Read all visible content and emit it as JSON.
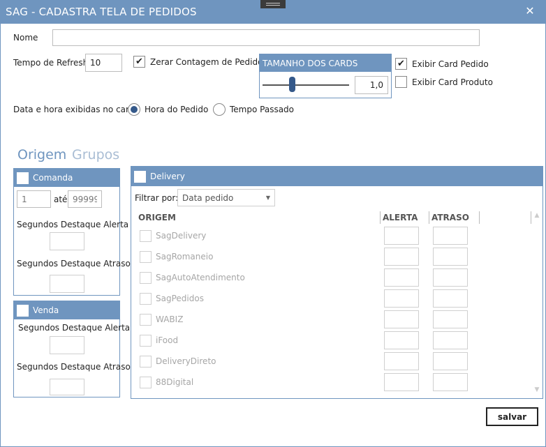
{
  "window": {
    "title": "SAG - CADASTRA TELA DE PEDIDOS",
    "close_icon": "close-icon"
  },
  "form": {
    "nome_label": "Nome",
    "nome_value": "",
    "refresh_label": "Tempo de Refresh",
    "refresh_value": "10",
    "zerar_label": "Zerar Contagem de Pedidos",
    "zerar_checked": true,
    "card_size_title": "TAMANHO DOS CARDS",
    "card_size_value": "1,0",
    "card_size_level": 0.3,
    "exibir_pedido_label": "Exibir Card Pedido",
    "exibir_pedido_checked": true,
    "exibir_produto_label": "Exibir Card Produto",
    "exibir_produto_checked": false,
    "data_hora_label": "Data e hora exibidas no card",
    "radio_hora_label": "Hora do Pedido",
    "radio_tempo_label": "Tempo Passado",
    "radio_selected": "Hora do Pedido"
  },
  "tabs": [
    {
      "label": "Origem",
      "active": true
    },
    {
      "label": "Grupos",
      "active": false
    }
  ],
  "comanda": {
    "title": "Comanda",
    "from_value": "1",
    "ate_label": "até",
    "to_value": "99999",
    "alerta_label": "Segundos Destaque Alerta",
    "atraso_label": "Segundos Destaque Atraso"
  },
  "venda": {
    "title": "Venda",
    "alerta_label": "Segundos Destaque Alerta",
    "atraso_label": "Segundos Destaque Atraso"
  },
  "delivery": {
    "title": "Delivery",
    "filter_label": "Filtrar por:",
    "filter_value": "Data pedido",
    "columns": [
      "ORIGEM",
      "ALERTA",
      "ATRASO"
    ],
    "origins": [
      "SagDelivery",
      "SagRomaneio",
      "SagAutoAtendimento",
      "SagPedidos",
      "WABIZ",
      "iFood",
      "DeliveryDireto",
      "88Digital"
    ]
  },
  "footer": {
    "save_label": "salvar"
  },
  "colors": {
    "accent": "#6f95bf",
    "accent_dark": "#35598a"
  }
}
